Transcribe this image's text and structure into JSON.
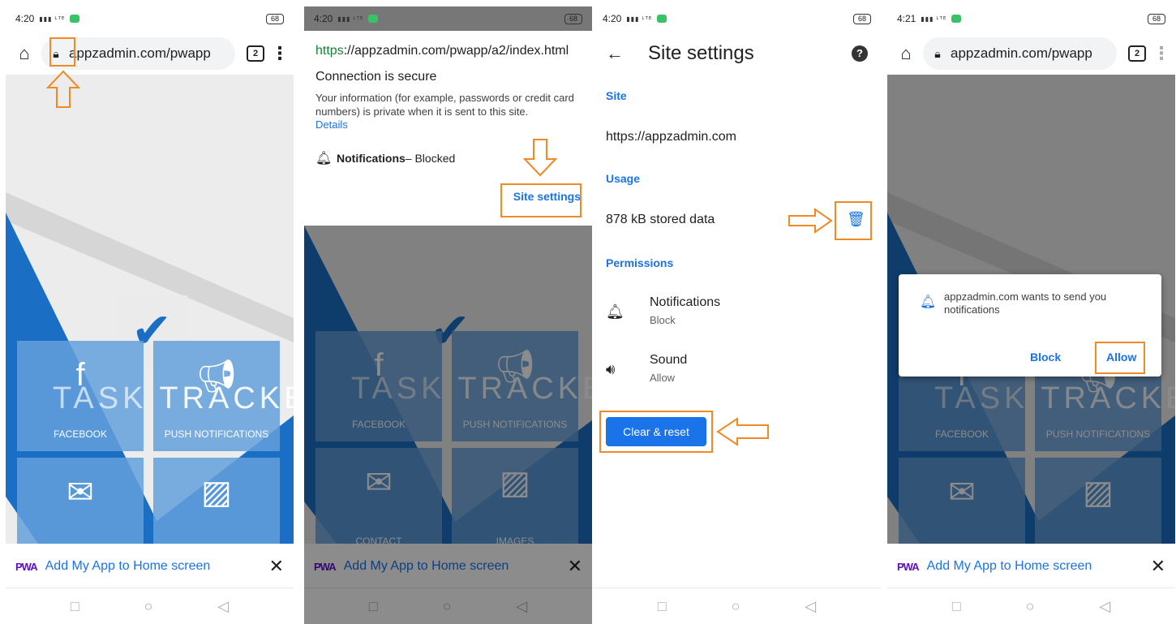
{
  "status": {
    "p1_time": "4:20",
    "p2_time": "4:20",
    "p3_time": "4:20",
    "p4_time": "4:21",
    "battery": "68"
  },
  "browser": {
    "url_short": "appzadmin.com/pwapp",
    "tab_count": "2"
  },
  "app_content": {
    "facebook": "FACEBOOK",
    "push": "PUSH NOTIFICATIONS",
    "contact": "CONTACT",
    "images": "IMAGES",
    "brand_left": "TASK",
    "brand_right": "TRACKER"
  },
  "install_banner": {
    "logo": "PWA",
    "text": "Add My App to Home screen",
    "close": "✕"
  },
  "page_info_popup": {
    "url_scheme": "https",
    "url_rest": "://appzadmin.com/pwapp/a2/index.html",
    "title": "Connection is secure",
    "info": "Your information (for example, passwords or credit card numbers) is private when it is sent to this site.",
    "details_link": "Details",
    "notif_label": "Notifications",
    "notif_state": " – Blocked",
    "site_settings": "Site settings"
  },
  "site_settings": {
    "title": "Site settings",
    "site_header": "Site",
    "site_url": "https://appzadmin.com",
    "usage_header": "Usage",
    "stored": "878 kB stored data",
    "perm_header": "Permissions",
    "perms": [
      {
        "name": "Notifications",
        "value": "Block"
      },
      {
        "name": "Sound",
        "value": "Allow"
      }
    ],
    "clear_button": "Clear & reset"
  },
  "notification_prompt": {
    "message": "appzadmin.com wants to send you notifications",
    "block": "Block",
    "allow": "Allow"
  },
  "colors": {
    "highlight": "#f08a24",
    "link": "#1a73e8",
    "secure": "#188038"
  }
}
